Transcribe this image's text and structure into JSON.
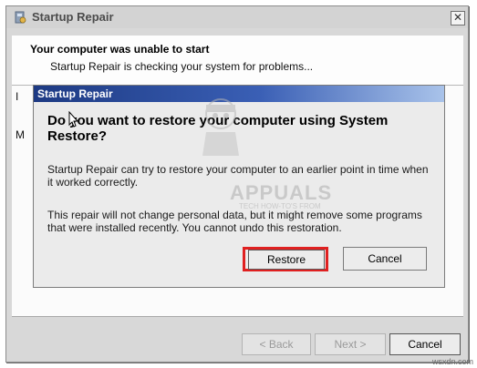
{
  "outer": {
    "title": "Startup Repair",
    "header_title": "Your computer was unable to start",
    "header_sub": "Startup Repair is checking your system for problems...",
    "stub_left_1": "I",
    "stub_left_2": "M",
    "buttons": {
      "back": "< Back",
      "next": "Next >",
      "cancel": "Cancel"
    }
  },
  "dialog": {
    "title": "Startup Repair",
    "question": "Do you want to restore your computer using System Restore?",
    "paragraph1": "Startup Repair can try to restore your computer to an earlier point in time when it worked correctly.",
    "paragraph2": "This repair will not change personal data, but it might remove some programs that were installed recently. You cannot undo this restoration.",
    "restore_label": "Restore",
    "cancel_label": "Cancel"
  },
  "watermark": {
    "name": "APPUALS",
    "tagline": "TECH HOW-TO'S FROM"
  },
  "credit": "wsxdn.com",
  "colors": {
    "highlight": "#e02020",
    "dialog_title_start": "#1d3a83",
    "dialog_title_end": "#a9c3ea"
  }
}
